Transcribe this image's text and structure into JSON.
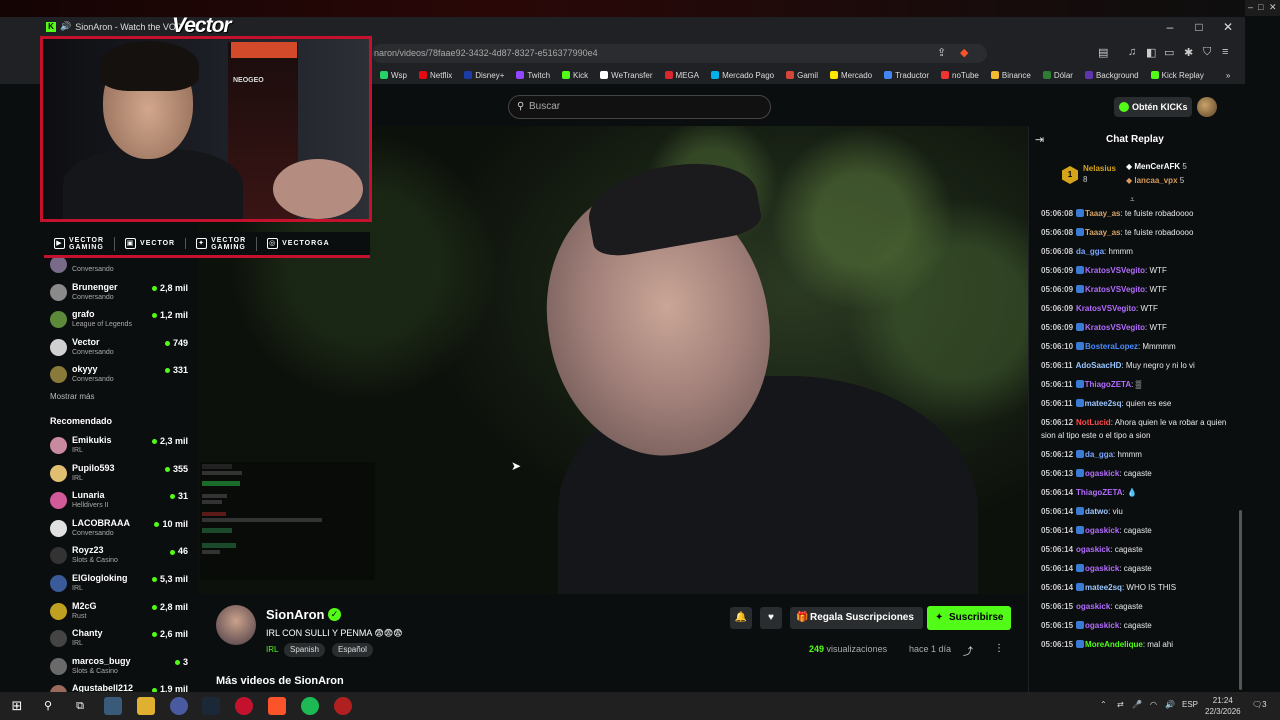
{
  "window": {
    "tab_title": "SionAron - Watch the VOD o",
    "url": "naron/videos/78faae92-3432-4d87-8327-e516377990e4",
    "controls": [
      "–",
      "□",
      "✕"
    ]
  },
  "bookmarks": [
    {
      "label": "Wsp",
      "color": "#25d366"
    },
    {
      "label": "Netflix",
      "color": "#e50914"
    },
    {
      "label": "Disney+",
      "color": "#1a3ca8"
    },
    {
      "label": "Twitch",
      "color": "#9146ff"
    },
    {
      "label": "Kick",
      "color": "#53fc18"
    },
    {
      "label": "WeTransfer",
      "color": "#ffffff"
    },
    {
      "label": "MEGA",
      "color": "#d9272e"
    },
    {
      "label": "Mercado Pago",
      "color": "#00b1ea"
    },
    {
      "label": "Gamil",
      "color": "#d44638"
    },
    {
      "label": "Mercado",
      "color": "#ffe600"
    },
    {
      "label": "Traductor",
      "color": "#4285f4"
    },
    {
      "label": "noTube",
      "color": "#e33"
    },
    {
      "label": "Binance",
      "color": "#f3ba2f"
    },
    {
      "label": "Dólar",
      "color": "#2e7d32"
    },
    {
      "label": "Background",
      "color": "#5e35b1"
    },
    {
      "label": "Kick Replay",
      "color": "#53fc18"
    }
  ],
  "header": {
    "search_placeholder": "Buscar",
    "get_kicks": "Obtén KICKs"
  },
  "overlay": {
    "logo_text": "Vector",
    "arcade_sign": "",
    "neo_label": "NEOGEO",
    "socials": [
      {
        "icon": "youtube-icon",
        "glyph": "▶",
        "label": "VECTOR\nGAMING"
      },
      {
        "icon": "twitch-icon",
        "glyph": "▣",
        "label": "VECTOR"
      },
      {
        "icon": "twitter-icon",
        "glyph": "✦",
        "label": "VECTOR\nGAMING"
      },
      {
        "icon": "instagram-icon",
        "glyph": "◎",
        "label": "VECTORGA"
      }
    ]
  },
  "sidebar": {
    "following": [
      {
        "name": "",
        "category": "Conversando",
        "viewers": "",
        "avatar_color": "#7a6a8a"
      },
      {
        "name": "Brunenger",
        "category": "Conversando",
        "viewers": "2,8 mil",
        "avatar_color": "#8a8a8a"
      },
      {
        "name": "grafo",
        "category": "League of Legends",
        "viewers": "1,2 mil",
        "avatar_color": "#5c8a3a"
      },
      {
        "name": "Vector",
        "category": "Conversando",
        "viewers": "749",
        "avatar_color": "#d0d0d0"
      },
      {
        "name": "okyyy",
        "category": "Conversando",
        "viewers": "331",
        "avatar_color": "#8a7a3a"
      }
    ],
    "show_more": "Mostrar más",
    "recommended_title": "Recomendado",
    "recommended": [
      {
        "name": "Emikukis",
        "category": "IRL",
        "viewers": "2,3 mil",
        "avatar_color": "#c98aa0"
      },
      {
        "name": "Pupilo593",
        "category": "IRL",
        "viewers": "355",
        "avatar_color": "#e0c070"
      },
      {
        "name": "Lunaria",
        "category": "Helldivers II",
        "viewers": "31",
        "avatar_color": "#d05a9a"
      },
      {
        "name": "LACOBRAAA",
        "category": "Conversando",
        "viewers": "10 mil",
        "avatar_color": "#e0e0e0"
      },
      {
        "name": "Royz23",
        "category": "Slots & Casino",
        "viewers": "46",
        "avatar_color": "#333333"
      },
      {
        "name": "ElGlogloking",
        "category": "IRL",
        "viewers": "5,3 mil",
        "avatar_color": "#3a5a9a"
      },
      {
        "name": "M2cG",
        "category": "Rust",
        "viewers": "2,8 mil",
        "avatar_color": "#c0a020"
      },
      {
        "name": "Chanty",
        "category": "IRL",
        "viewers": "2,6 mil",
        "avatar_color": "#444444"
      },
      {
        "name": "marcos_bugy",
        "category": "Slots & Casino",
        "viewers": "3",
        "avatar_color": "#6a6a6a"
      },
      {
        "name": "Agustabell212",
        "category": "",
        "viewers": "1,9 mil",
        "avatar_color": "#9a6a5a"
      }
    ]
  },
  "channel": {
    "name": "SionAron",
    "title": "IRL CON SULLI Y PENMA 😨😨😨",
    "category": "IRL",
    "tags": [
      "Spanish",
      "Español"
    ],
    "views_count": "249",
    "views_label": "visualizaciones",
    "time_ago": "hace 1 día",
    "gift_label": "Regala Suscripciones",
    "subscribe_label": "Suscribirse",
    "more_videos": "Más videos de SionAron"
  },
  "chat": {
    "title": "Chat Replay",
    "leaders": {
      "first_rank": "1",
      "first_name": "Nelasius",
      "first_value": "8",
      "second_name": "MenCerAFK",
      "second_value": "5",
      "third_name": "lancaa_vpx",
      "third_value": "5"
    },
    "messages": [
      {
        "time": "05:06:08",
        "user": "Taaay_as",
        "color": "#d6a36a",
        "text": "te fuiste robadoooo"
      },
      {
        "time": "05:06:08",
        "user": "Taaay_as",
        "color": "#d6a36a",
        "text": "te fuiste robadoooo"
      },
      {
        "time": "05:06:08",
        "user": "da_gga",
        "color": "#7aa6ff",
        "text": "hmmm"
      },
      {
        "time": "05:06:09",
        "user": "KratosVSVegito",
        "color": "#b36cff",
        "text": "WTF"
      },
      {
        "time": "05:06:09",
        "user": "KratosVSVegito",
        "color": "#b36cff",
        "text": "WTF"
      },
      {
        "time": "05:06:09",
        "user": "KratosVSVegito",
        "color": "#b36cff",
        "text": "WTF"
      },
      {
        "time": "05:06:09",
        "user": "KratosVSVegito",
        "color": "#b36cff",
        "text": "WTF"
      },
      {
        "time": "05:06:10",
        "user": "BosteraLopez",
        "color": "#4a8cff",
        "text": "Mmmmm"
      },
      {
        "time": "05:06:11",
        "user": "AdoSaacHD",
        "color": "#9ac6ff",
        "text": "Muy negro y ni lo vi"
      },
      {
        "time": "05:06:11",
        "user": "ThiagoZETA",
        "color": "#b36cff",
        "text": "▒"
      },
      {
        "time": "05:06:11",
        "user": "matee2sq",
        "color": "#9ac6ff",
        "text": "quien es ese"
      },
      {
        "time": "05:06:12",
        "user": "NotLucid",
        "color": "#ff4a4a",
        "text": "Ahora quien le va robar a quien sion al tipo este o el tipo a sion"
      },
      {
        "time": "05:06:12",
        "user": "da_gga",
        "color": "#7aa6ff",
        "text": "hmmm"
      },
      {
        "time": "05:06:13",
        "user": "ogaskick",
        "color": "#b36cff",
        "text": "cagaste"
      },
      {
        "time": "05:06:14",
        "user": "ThiagoZETA",
        "color": "#b36cff",
        "text": "💧"
      },
      {
        "time": "05:06:14",
        "user": "datwo",
        "color": "#9ac6ff",
        "text": "viu"
      },
      {
        "time": "05:06:14",
        "user": "ogaskick",
        "color": "#b36cff",
        "text": "cagaste"
      },
      {
        "time": "05:06:14",
        "user": "ogaskick",
        "color": "#b36cff",
        "text": "cagaste"
      },
      {
        "time": "05:06:14",
        "user": "ogaskick",
        "color": "#b36cff",
        "text": "cagaste"
      },
      {
        "time": "05:06:14",
        "user": "matee2sq",
        "color": "#9ac6ff",
        "text": "WHO IS THIS"
      },
      {
        "time": "05:06:15",
        "user": "ogaskick",
        "color": "#b36cff",
        "text": "cagaste"
      },
      {
        "time": "05:06:15",
        "user": "ogaskick",
        "color": "#b36cff",
        "text": "cagaste"
      },
      {
        "time": "05:06:15",
        "user": "MoreAndelique",
        "color": "#53fc18",
        "text": "mal ahi"
      }
    ]
  },
  "taskbar": {
    "lang": "ESP",
    "time": "21:24",
    "date": "22/3/2026",
    "notif": "3"
  }
}
